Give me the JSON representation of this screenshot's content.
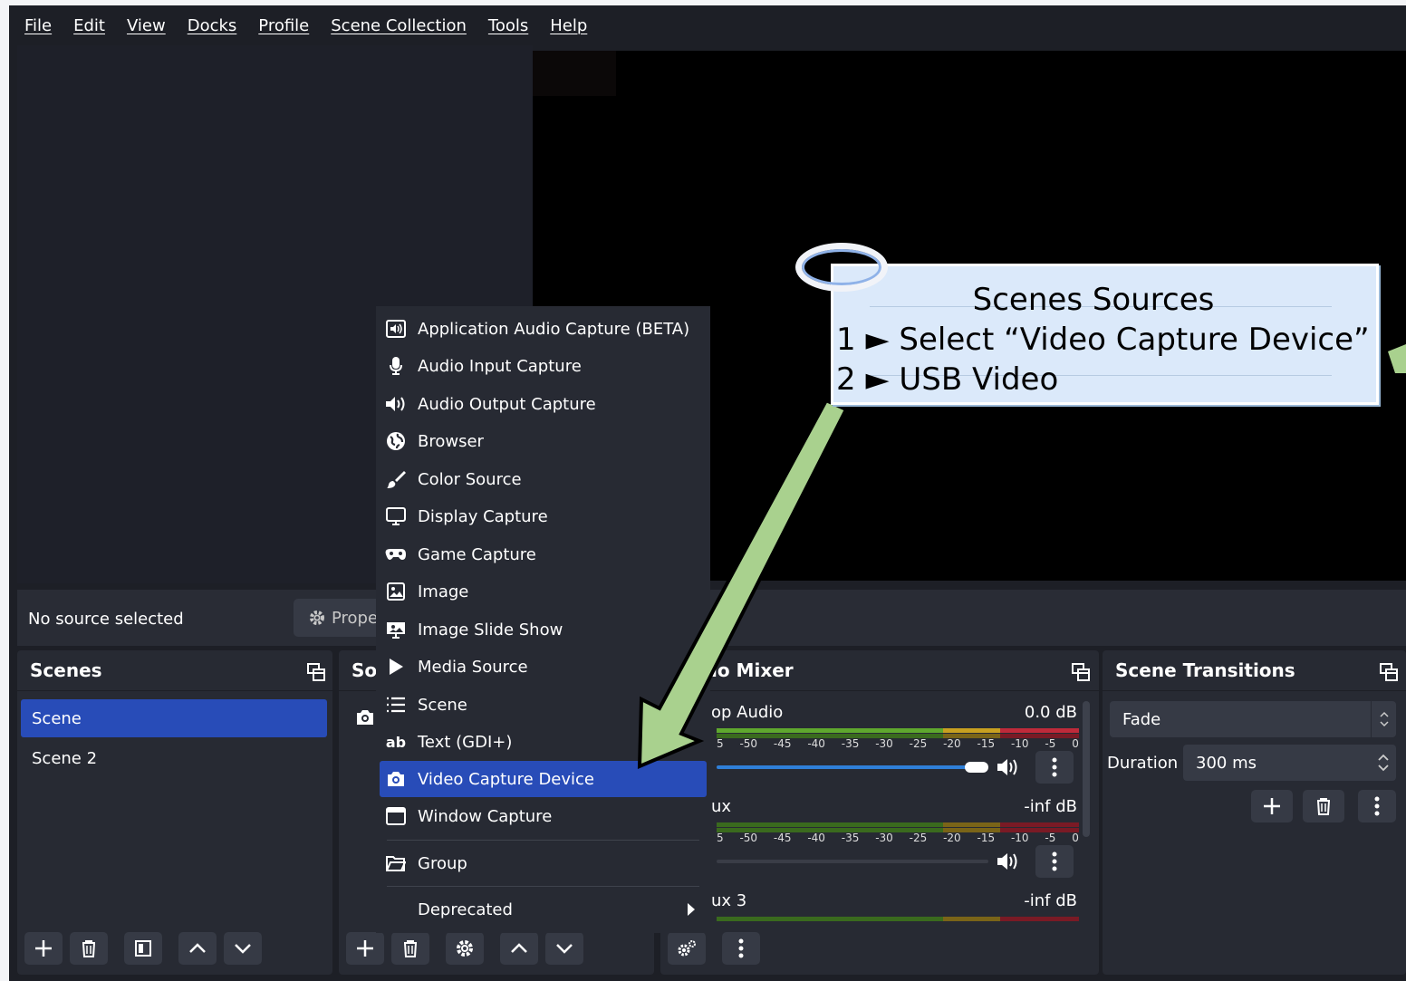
{
  "menubar": {
    "items": [
      "File",
      "Edit",
      "View",
      "Docks",
      "Profile",
      "Scene Collection",
      "Tools",
      "Help"
    ]
  },
  "context_bar": {
    "status": "No source selected",
    "properties_label": "Prope"
  },
  "scenes": {
    "title": "Scenes",
    "items": [
      "Scene",
      "Scene 2"
    ],
    "selected": "Scene"
  },
  "sources": {
    "title": "So"
  },
  "mixer": {
    "title": "io Mixer",
    "channels": [
      {
        "name": "op Audio",
        "db": "0.0 dB"
      },
      {
        "name": "ux",
        "db": "-inf dB"
      },
      {
        "name": "ux 3",
        "db": "-inf dB"
      }
    ],
    "scale": [
      "5",
      "-50",
      "-45",
      "-40",
      "-35",
      "-30",
      "-25",
      "-20",
      "-15",
      "-10",
      "-5",
      "0"
    ]
  },
  "transitions": {
    "title": "Scene Transitions",
    "transition": "Fade",
    "duration_label": "Duration",
    "duration_value": "300 ms"
  },
  "context_menu": {
    "items": [
      {
        "label": "Application Audio Capture (BETA)",
        "icon": "app-audio-icon"
      },
      {
        "label": "Audio Input Capture",
        "icon": "microphone-icon"
      },
      {
        "label": "Audio Output Capture",
        "icon": "speaker-icon"
      },
      {
        "label": "Browser",
        "icon": "globe-icon"
      },
      {
        "label": "Color Source",
        "icon": "paintbrush-icon"
      },
      {
        "label": "Display Capture",
        "icon": "monitor-icon"
      },
      {
        "label": "Game Capture",
        "icon": "gamepad-icon"
      },
      {
        "label": "Image",
        "icon": "image-icon"
      },
      {
        "label": "Image Slide Show",
        "icon": "slideshow-icon"
      },
      {
        "label": "Media Source",
        "icon": "play-icon"
      },
      {
        "label": "Scene",
        "icon": "list-icon"
      },
      {
        "label": "Text (GDI+)",
        "icon": "text-icon"
      },
      {
        "label": "Video Capture Device",
        "icon": "camera-icon"
      },
      {
        "label": "Window Capture",
        "icon": "window-icon"
      },
      {
        "label": "Group",
        "icon": "folder-icon"
      },
      {
        "label": "Deprecated",
        "icon": ""
      }
    ],
    "selected": "Video Capture Device"
  },
  "annotation": {
    "title": "Scenes Sources",
    "line1": "1 ► Select “Video Capture Device”",
    "line2": "2 ► USB Video"
  },
  "colors": {
    "accent": "#284cb8",
    "panel": "#272a33",
    "background": "#1d1f26",
    "callout": "#dbe9fa",
    "arrow": "#a9d18e"
  }
}
